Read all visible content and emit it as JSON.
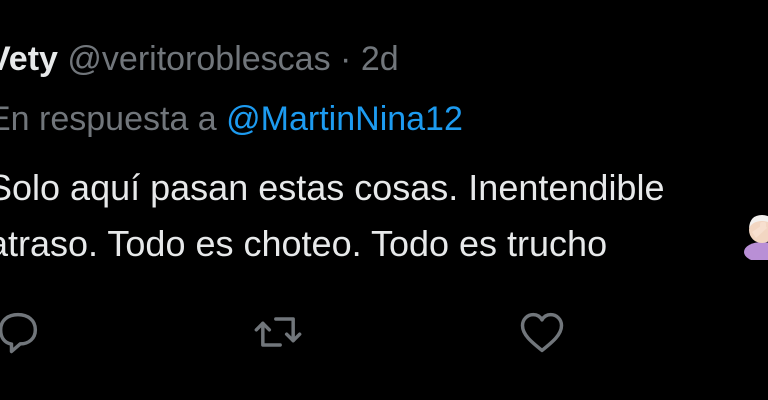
{
  "tweet": {
    "display_name": "Vety",
    "handle": "@veritoroblescas",
    "separator": "·",
    "time": "2d",
    "reply_prefix": "En respuesta a",
    "reply_mention": "@MartinNina12",
    "text_line_1": "Solo aquí pasan estas cosas. Inentendible",
    "text_line_2": "atraso. Todo es choteo. Todo es trucho",
    "emoji": "person-facepalming"
  },
  "actions": {
    "reply_icon": "reply-icon",
    "retweet_icon": "retweet-icon",
    "like_icon": "heart-icon"
  },
  "colors": {
    "background": "#000000",
    "primary_text": "#e7e9ea",
    "secondary_text": "#71767b",
    "link": "#1d9bf0"
  }
}
